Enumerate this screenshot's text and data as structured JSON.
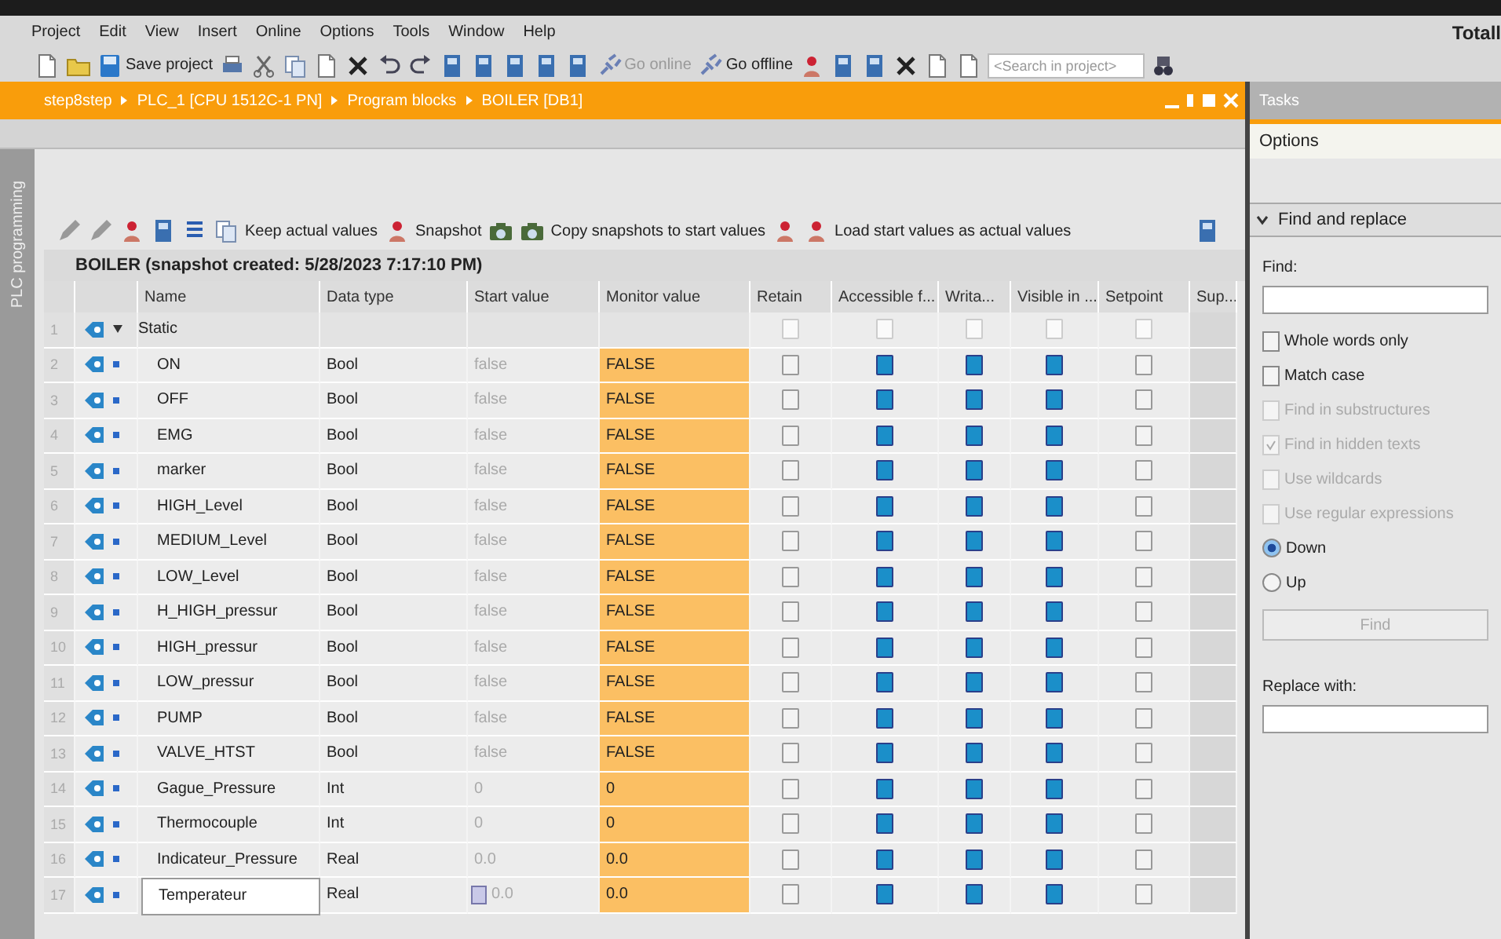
{
  "app_title": "Totall",
  "menu": [
    "Project",
    "Edit",
    "View",
    "Insert",
    "Online",
    "Options",
    "Tools",
    "Window",
    "Help"
  ],
  "toolbar": {
    "save": "Save project",
    "go_online": "Go online",
    "go_online_disabled": true,
    "go_offline": "Go offline",
    "search_placeholder": "<Search in project>"
  },
  "breadcrumb": [
    "step8step",
    "PLC_1 [CPU 1512C-1 PN]",
    "Program blocks",
    "BOILER [DB1]"
  ],
  "side_tab": "PLC programming",
  "block_toolbar": {
    "keep": "Keep actual values",
    "snapshot": "Snapshot",
    "copy": "Copy snapshots to start values",
    "load": "Load start values as actual values"
  },
  "block_title": "BOILER (snapshot created: 5/28/2023 7:17:10 PM)",
  "columns": [
    "Name",
    "Data type",
    "Start value",
    "Monitor value",
    "Retain",
    "Accessible f...",
    "Writa...",
    "Visible in ...",
    "Setpoint",
    "Sup..."
  ],
  "rows": [
    {
      "num": "1",
      "kind": "section",
      "expanded": true,
      "name": "Static",
      "retain": false,
      "accessible": false,
      "writable": false,
      "visible": false,
      "setpoint": false
    },
    {
      "num": "2",
      "kind": "tag",
      "name": "ON",
      "data_type": "Bool",
      "start_value": "false",
      "monitor_value": "FALSE",
      "retain": false,
      "accessible": true,
      "writable": true,
      "visible": true,
      "setpoint": false
    },
    {
      "num": "3",
      "kind": "tag",
      "name": "OFF",
      "data_type": "Bool",
      "start_value": "false",
      "monitor_value": "FALSE",
      "retain": false,
      "accessible": true,
      "writable": true,
      "visible": true,
      "setpoint": false
    },
    {
      "num": "4",
      "kind": "tag",
      "name": "EMG",
      "data_type": "Bool",
      "start_value": "false",
      "monitor_value": "FALSE",
      "retain": false,
      "accessible": true,
      "writable": true,
      "visible": true,
      "setpoint": false
    },
    {
      "num": "5",
      "kind": "tag",
      "name": "marker",
      "data_type": "Bool",
      "start_value": "false",
      "monitor_value": "FALSE",
      "retain": false,
      "accessible": true,
      "writable": true,
      "visible": true,
      "setpoint": false
    },
    {
      "num": "6",
      "kind": "tag",
      "name": "HIGH_Level",
      "data_type": "Bool",
      "start_value": "false",
      "monitor_value": "FALSE",
      "retain": false,
      "accessible": true,
      "writable": true,
      "visible": true,
      "setpoint": false
    },
    {
      "num": "7",
      "kind": "tag",
      "name": "MEDIUM_Level",
      "data_type": "Bool",
      "start_value": "false",
      "monitor_value": "FALSE",
      "retain": false,
      "accessible": true,
      "writable": true,
      "visible": true,
      "setpoint": false
    },
    {
      "num": "8",
      "kind": "tag",
      "name": "LOW_Level",
      "data_type": "Bool",
      "start_value": "false",
      "monitor_value": "FALSE",
      "retain": false,
      "accessible": true,
      "writable": true,
      "visible": true,
      "setpoint": false
    },
    {
      "num": "9",
      "kind": "tag",
      "name": "H_HIGH_pressur",
      "data_type": "Bool",
      "start_value": "false",
      "monitor_value": "FALSE",
      "retain": false,
      "accessible": true,
      "writable": true,
      "visible": true,
      "setpoint": false
    },
    {
      "num": "10",
      "kind": "tag",
      "name": "HIGH_pressur",
      "data_type": "Bool",
      "start_value": "false",
      "monitor_value": "FALSE",
      "retain": false,
      "accessible": true,
      "writable": true,
      "visible": true,
      "setpoint": false
    },
    {
      "num": "11",
      "kind": "tag",
      "name": "LOW_pressur",
      "data_type": "Bool",
      "start_value": "false",
      "monitor_value": "FALSE",
      "retain": false,
      "accessible": true,
      "writable": true,
      "visible": true,
      "setpoint": false
    },
    {
      "num": "12",
      "kind": "tag",
      "name": "PUMP",
      "data_type": "Bool",
      "start_value": "false",
      "monitor_value": "FALSE",
      "retain": false,
      "accessible": true,
      "writable": true,
      "visible": true,
      "setpoint": false
    },
    {
      "num": "13",
      "kind": "tag",
      "name": "VALVE_HTST",
      "data_type": "Bool",
      "start_value": "false",
      "monitor_value": "FALSE",
      "retain": false,
      "accessible": true,
      "writable": true,
      "visible": true,
      "setpoint": false
    },
    {
      "num": "14",
      "kind": "tag",
      "name": "Gague_Pressure",
      "data_type": "Int",
      "start_value": "0",
      "monitor_value": "0",
      "retain": false,
      "accessible": true,
      "writable": true,
      "visible": true,
      "setpoint": false
    },
    {
      "num": "15",
      "kind": "tag",
      "name": "Thermocouple",
      "data_type": "Int",
      "start_value": "0",
      "monitor_value": "0",
      "retain": false,
      "accessible": true,
      "writable": true,
      "visible": true,
      "setpoint": false
    },
    {
      "num": "16",
      "kind": "tag",
      "name": "Indicateur_Pressure",
      "data_type": "Real",
      "start_value": "0.0",
      "monitor_value": "0.0",
      "retain": false,
      "accessible": true,
      "writable": true,
      "visible": true,
      "setpoint": false
    },
    {
      "num": "17",
      "kind": "tag",
      "editing": true,
      "name": "Temperateur",
      "data_type": "Real",
      "start_value": "0.0",
      "monitor_value": "0.0",
      "retain": false,
      "accessible": true,
      "writable": true,
      "visible": true,
      "setpoint": false
    }
  ],
  "tasks": {
    "title": "Tasks",
    "options": "Options",
    "section": "Find and replace",
    "section_expanded": true,
    "find_label": "Find:",
    "checks": [
      {
        "label": "Whole words only",
        "checked": false,
        "disabled": false
      },
      {
        "label": "Match case",
        "checked": false,
        "disabled": false
      },
      {
        "label": "Find in substructures",
        "checked": false,
        "disabled": true
      },
      {
        "label": "Find in hidden texts",
        "checked": true,
        "disabled": true
      },
      {
        "label": "Use wildcards",
        "checked": false,
        "disabled": true
      },
      {
        "label": "Use regular expressions",
        "checked": false,
        "disabled": true
      }
    ],
    "directions": [
      {
        "label": "Down",
        "selected": true
      },
      {
        "label": "Up",
        "selected": false
      }
    ],
    "find_button": "Find",
    "find_button_disabled": true,
    "replace_label": "Replace with:"
  }
}
